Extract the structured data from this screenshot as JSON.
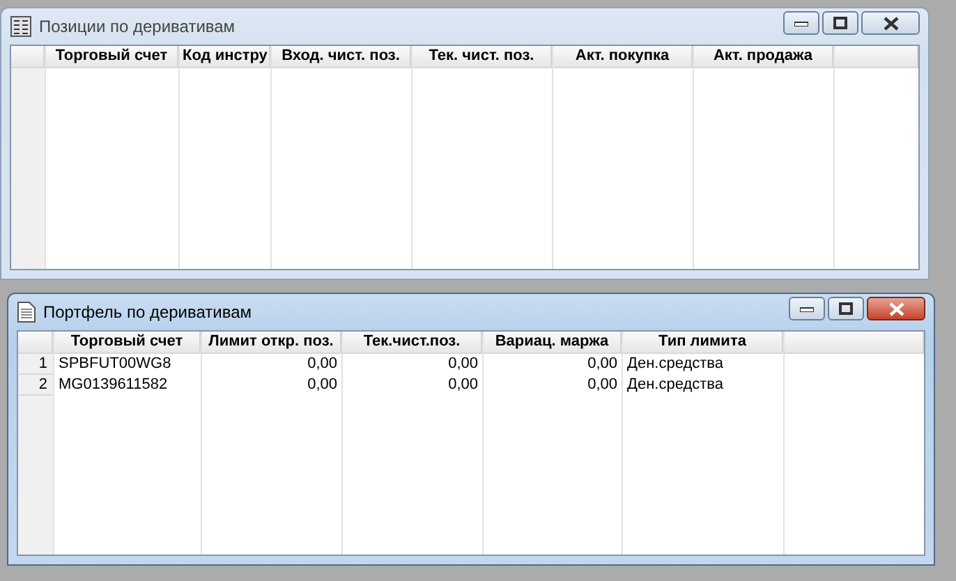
{
  "windows": [
    {
      "title": "Позиции по деривативам",
      "active": false,
      "columns": [
        {
          "label": "Торговый счет"
        },
        {
          "label": "Код инстру"
        },
        {
          "label": "Вход. чист. поз."
        },
        {
          "label": "Тек. чист. поз."
        },
        {
          "label": "Акт. покупка"
        },
        {
          "label": "Акт. продажа"
        }
      ]
    },
    {
      "title": "Портфель по деривативам",
      "active": true,
      "columns": [
        {
          "label": "Торговый счет",
          "kind": "text"
        },
        {
          "label": "Лимит откр. поз.",
          "kind": "number"
        },
        {
          "label": "Тек.чист.поз.",
          "kind": "number"
        },
        {
          "label": "Вариац. маржа",
          "kind": "number"
        },
        {
          "label": "Тип лимита",
          "kind": "text"
        }
      ],
      "rows": [
        {
          "number": "1",
          "cells": [
            "SPBFUT00WG8",
            "0,00",
            "0,00",
            "0,00",
            "Ден.средства"
          ]
        },
        {
          "number": "2",
          "cells": [
            "MG0139611582",
            "0,00",
            "0,00",
            "0,00",
            "Ден.средства"
          ]
        }
      ]
    }
  ]
}
